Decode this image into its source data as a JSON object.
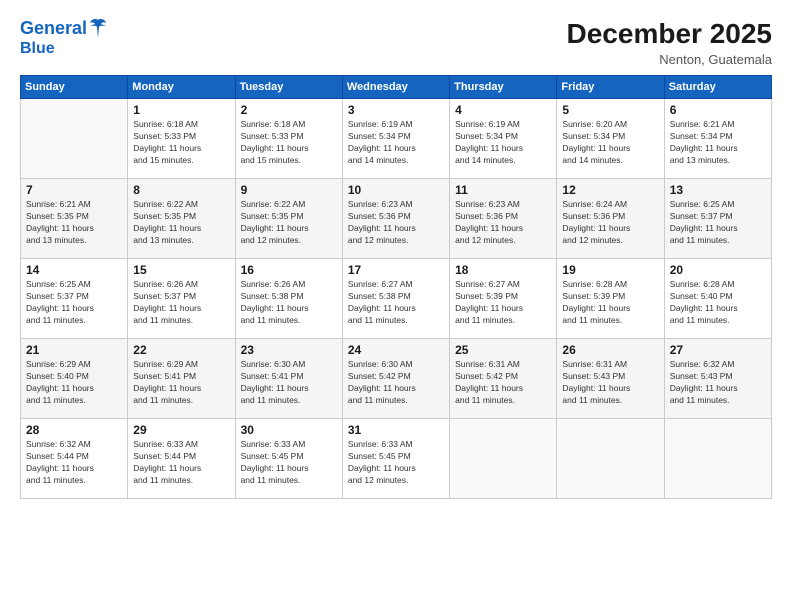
{
  "logo": {
    "line1": "General",
    "line2": "Blue"
  },
  "title": "December 2025",
  "location": "Nenton, Guatemala",
  "days_of_week": [
    "Sunday",
    "Monday",
    "Tuesday",
    "Wednesday",
    "Thursday",
    "Friday",
    "Saturday"
  ],
  "weeks": [
    [
      {
        "num": "",
        "info": ""
      },
      {
        "num": "1",
        "info": "Sunrise: 6:18 AM\nSunset: 5:33 PM\nDaylight: 11 hours\nand 15 minutes."
      },
      {
        "num": "2",
        "info": "Sunrise: 6:18 AM\nSunset: 5:33 PM\nDaylight: 11 hours\nand 15 minutes."
      },
      {
        "num": "3",
        "info": "Sunrise: 6:19 AM\nSunset: 5:34 PM\nDaylight: 11 hours\nand 14 minutes."
      },
      {
        "num": "4",
        "info": "Sunrise: 6:19 AM\nSunset: 5:34 PM\nDaylight: 11 hours\nand 14 minutes."
      },
      {
        "num": "5",
        "info": "Sunrise: 6:20 AM\nSunset: 5:34 PM\nDaylight: 11 hours\nand 14 minutes."
      },
      {
        "num": "6",
        "info": "Sunrise: 6:21 AM\nSunset: 5:34 PM\nDaylight: 11 hours\nand 13 minutes."
      }
    ],
    [
      {
        "num": "7",
        "info": "Sunrise: 6:21 AM\nSunset: 5:35 PM\nDaylight: 11 hours\nand 13 minutes."
      },
      {
        "num": "8",
        "info": "Sunrise: 6:22 AM\nSunset: 5:35 PM\nDaylight: 11 hours\nand 13 minutes."
      },
      {
        "num": "9",
        "info": "Sunrise: 6:22 AM\nSunset: 5:35 PM\nDaylight: 11 hours\nand 12 minutes."
      },
      {
        "num": "10",
        "info": "Sunrise: 6:23 AM\nSunset: 5:36 PM\nDaylight: 11 hours\nand 12 minutes."
      },
      {
        "num": "11",
        "info": "Sunrise: 6:23 AM\nSunset: 5:36 PM\nDaylight: 11 hours\nand 12 minutes."
      },
      {
        "num": "12",
        "info": "Sunrise: 6:24 AM\nSunset: 5:36 PM\nDaylight: 11 hours\nand 12 minutes."
      },
      {
        "num": "13",
        "info": "Sunrise: 6:25 AM\nSunset: 5:37 PM\nDaylight: 11 hours\nand 11 minutes."
      }
    ],
    [
      {
        "num": "14",
        "info": "Sunrise: 6:25 AM\nSunset: 5:37 PM\nDaylight: 11 hours\nand 11 minutes."
      },
      {
        "num": "15",
        "info": "Sunrise: 6:26 AM\nSunset: 5:37 PM\nDaylight: 11 hours\nand 11 minutes."
      },
      {
        "num": "16",
        "info": "Sunrise: 6:26 AM\nSunset: 5:38 PM\nDaylight: 11 hours\nand 11 minutes."
      },
      {
        "num": "17",
        "info": "Sunrise: 6:27 AM\nSunset: 5:38 PM\nDaylight: 11 hours\nand 11 minutes."
      },
      {
        "num": "18",
        "info": "Sunrise: 6:27 AM\nSunset: 5:39 PM\nDaylight: 11 hours\nand 11 minutes."
      },
      {
        "num": "19",
        "info": "Sunrise: 6:28 AM\nSunset: 5:39 PM\nDaylight: 11 hours\nand 11 minutes."
      },
      {
        "num": "20",
        "info": "Sunrise: 6:28 AM\nSunset: 5:40 PM\nDaylight: 11 hours\nand 11 minutes."
      }
    ],
    [
      {
        "num": "21",
        "info": "Sunrise: 6:29 AM\nSunset: 5:40 PM\nDaylight: 11 hours\nand 11 minutes."
      },
      {
        "num": "22",
        "info": "Sunrise: 6:29 AM\nSunset: 5:41 PM\nDaylight: 11 hours\nand 11 minutes."
      },
      {
        "num": "23",
        "info": "Sunrise: 6:30 AM\nSunset: 5:41 PM\nDaylight: 11 hours\nand 11 minutes."
      },
      {
        "num": "24",
        "info": "Sunrise: 6:30 AM\nSunset: 5:42 PM\nDaylight: 11 hours\nand 11 minutes."
      },
      {
        "num": "25",
        "info": "Sunrise: 6:31 AM\nSunset: 5:42 PM\nDaylight: 11 hours\nand 11 minutes."
      },
      {
        "num": "26",
        "info": "Sunrise: 6:31 AM\nSunset: 5:43 PM\nDaylight: 11 hours\nand 11 minutes."
      },
      {
        "num": "27",
        "info": "Sunrise: 6:32 AM\nSunset: 5:43 PM\nDaylight: 11 hours\nand 11 minutes."
      }
    ],
    [
      {
        "num": "28",
        "info": "Sunrise: 6:32 AM\nSunset: 5:44 PM\nDaylight: 11 hours\nand 11 minutes."
      },
      {
        "num": "29",
        "info": "Sunrise: 6:33 AM\nSunset: 5:44 PM\nDaylight: 11 hours\nand 11 minutes."
      },
      {
        "num": "30",
        "info": "Sunrise: 6:33 AM\nSunset: 5:45 PM\nDaylight: 11 hours\nand 11 minutes."
      },
      {
        "num": "31",
        "info": "Sunrise: 6:33 AM\nSunset: 5:45 PM\nDaylight: 11 hours\nand 12 minutes."
      },
      {
        "num": "",
        "info": ""
      },
      {
        "num": "",
        "info": ""
      },
      {
        "num": "",
        "info": ""
      }
    ]
  ]
}
